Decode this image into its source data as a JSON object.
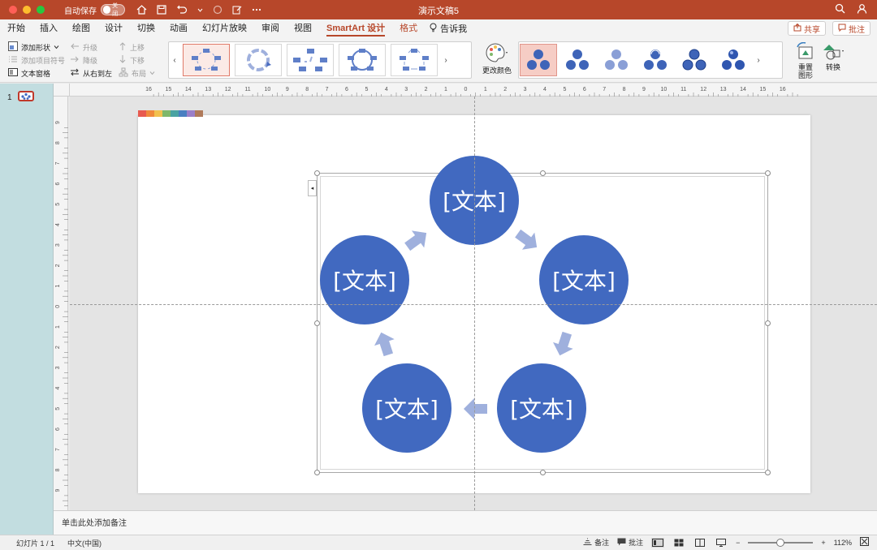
{
  "window": {
    "title": "演示文稿5",
    "autosave_label": "自动保存",
    "autosave_state": "关闭"
  },
  "tabs": [
    {
      "label": "开始"
    },
    {
      "label": "插入"
    },
    {
      "label": "绘图"
    },
    {
      "label": "设计"
    },
    {
      "label": "切换"
    },
    {
      "label": "动画"
    },
    {
      "label": "幻灯片放映"
    },
    {
      "label": "审阅"
    },
    {
      "label": "视图"
    },
    {
      "label": "SmartArt 设计"
    },
    {
      "label": "格式"
    }
  ],
  "tell_me": "告诉我",
  "share": {
    "share_label": "共享",
    "comment_label": "批注"
  },
  "ribbon": {
    "add_shape": "添加形状",
    "add_bullet": "添加项目符号",
    "text_pane": "文本窗格",
    "promote": "升级",
    "demote": "降级",
    "right_to_left": "从右到左",
    "move_up": "上移",
    "move_down": "下移",
    "layout": "布局",
    "change_colors": "更改颜色",
    "reset_graphic": "重置图形",
    "convert": "转换"
  },
  "ruler": {
    "h_labels": [
      "16",
      "15",
      "14",
      "13",
      "12",
      "11",
      "10",
      "9",
      "8",
      "7",
      "6",
      "5",
      "4",
      "3",
      "2",
      "1",
      "0",
      "1",
      "2",
      "3",
      "4",
      "5",
      "6",
      "7",
      "8",
      "9",
      "10",
      "11",
      "12",
      "13",
      "14",
      "15",
      "16"
    ],
    "v_labels": [
      "9",
      "8",
      "7",
      "6",
      "5",
      "4",
      "3",
      "2",
      "1",
      "0",
      "1",
      "2",
      "3",
      "4",
      "5",
      "6",
      "7",
      "8",
      "9"
    ]
  },
  "slides_pane": {
    "number": "1"
  },
  "smartart": {
    "nodes": [
      "[文本]",
      "[文本]",
      "[文本]",
      "[文本]",
      "[文本]"
    ],
    "node_color": "#4169c0",
    "arrow_color": "#9fb0dd"
  },
  "notes_placeholder": "单击此处添加备注",
  "status": {
    "slide_info": "幻灯片 1 / 1",
    "language": "中文(中国)",
    "notes": "备注",
    "comments": "批注",
    "zoom": "112%"
  },
  "theme": {
    "accent": "#b7472a",
    "color_strip": [
      "#e85a4f",
      "#f08a3c",
      "#f2c14e",
      "#7fb86b",
      "#4aa3a2",
      "#4a7fc1",
      "#9b7fc9",
      "#b07a5a"
    ]
  }
}
